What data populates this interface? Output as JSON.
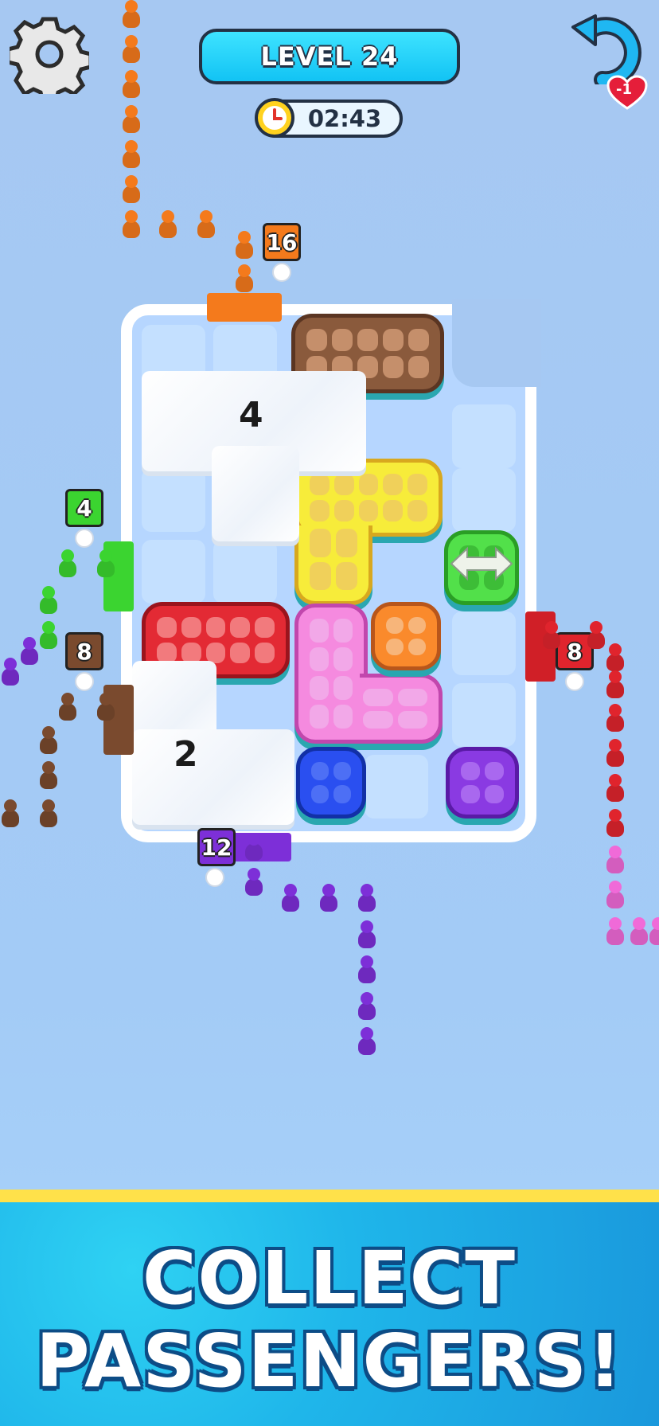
{
  "header": {
    "level_label": "LEVEL 24",
    "timer": "02:43",
    "lives_change": "-1"
  },
  "icons": {
    "settings": "gear-icon",
    "timer": "clock-icon",
    "undo": "undo-arrow-icon",
    "lives": "heart-icon",
    "move_hint": "double-arrow-icon"
  },
  "gates": {
    "orange_count": "16",
    "green_count": "4",
    "brown_count": "8",
    "red_count": "8",
    "purple_count": "12"
  },
  "frozen_blocks": {
    "top_count": "4",
    "bottom_count": "2"
  },
  "colors": {
    "orange": "#f47a1c",
    "green": "#3bd430",
    "brown": "#7a4a2e",
    "red": "#e0242d",
    "purple": "#7d2fd8",
    "pink": "#f06ad8",
    "yellow": "#f5e62a",
    "blue": "#2147e8"
  },
  "banner": {
    "line1": "COLLECT",
    "line2": "PASSENGERS!"
  }
}
